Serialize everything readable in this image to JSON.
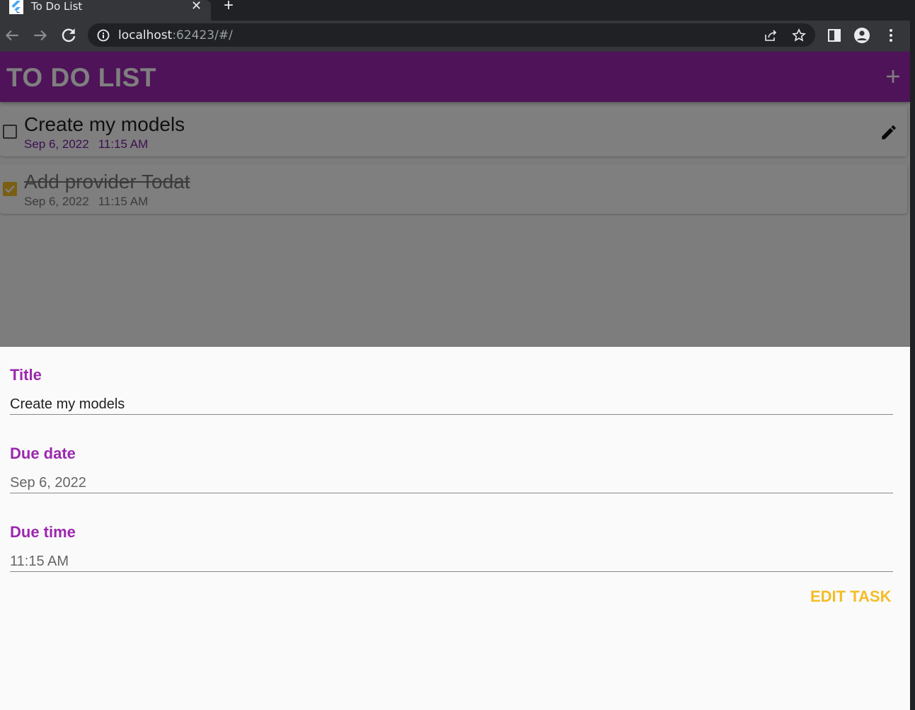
{
  "browser": {
    "tab_title": "To Do List",
    "new_tab_symbol": "+",
    "close_symbol": "✕",
    "url_host": "localhost",
    "url_rest": ":62423/#/"
  },
  "app": {
    "title": "TO DO LIST",
    "accent_color": "#9c27b0",
    "highlight_color": "#f4bd26"
  },
  "tasks": [
    {
      "title": "Create my models",
      "date": "Sep 6, 2022",
      "time": "11:15 AM",
      "done": false
    },
    {
      "title": "Add provider Todat",
      "date": "Sep 6, 2022",
      "time": "11:15 AM",
      "done": true
    }
  ],
  "edit_sheet": {
    "title_label": "Title",
    "title_value": "Create my models",
    "date_label": "Due date",
    "date_value": "Sep 6, 2022",
    "time_label": "Due time",
    "time_value": "11:15 AM",
    "submit_label": "EDIT TASK"
  }
}
